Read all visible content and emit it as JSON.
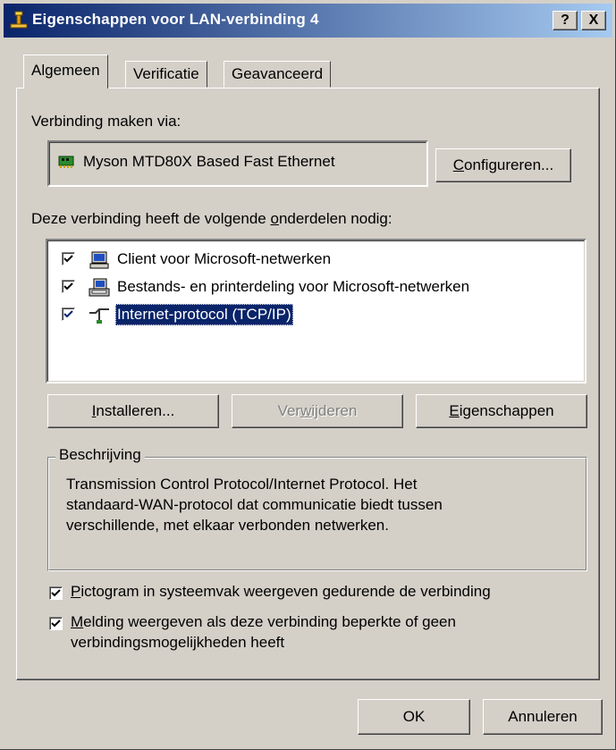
{
  "window": {
    "title": "Eigenschappen voor LAN-verbinding 4",
    "help_label": "?",
    "close_label": "X"
  },
  "tabs": [
    {
      "label": "Algemeen",
      "active": true
    },
    {
      "label": "Verificatie",
      "active": false
    },
    {
      "label": "Geavanceerd",
      "active": false
    }
  ],
  "connect_via": {
    "label": "Verbinding maken via:",
    "adapter": "Myson MTD80X Based Fast Ethernet",
    "configure_prefix": "",
    "configure_key": "C",
    "configure_rest": "onfigureren..."
  },
  "components": {
    "label_prefix": "Deze verbinding heeft de volgende ",
    "label_key": "o",
    "label_rest": "nderdelen nodig:",
    "items": [
      {
        "label": "Client voor Microsoft-netwerken",
        "checked": true,
        "icon": "network-client-icon",
        "selected": false
      },
      {
        "label": "Bestands- en printerdeling voor Microsoft-netwerken",
        "checked": true,
        "icon": "file-printer-sharing-icon",
        "selected": false
      },
      {
        "label": "Internet-protocol (TCP/IP)",
        "checked": true,
        "icon": "protocol-icon",
        "selected": true
      }
    ]
  },
  "buttons": {
    "install": {
      "key": "I",
      "rest": "nstalleren..."
    },
    "remove": {
      "pre": "Ver",
      "key": "w",
      "rest": "ijderen"
    },
    "properties": {
      "key": "E",
      "rest": "igenschappen"
    }
  },
  "description": {
    "legend": "Beschrijving",
    "lines": [
      "Transmission Control Protocol/Internet Protocol. Het",
      "standaard-WAN-protocol dat communicatie biedt tussen",
      "verschillende, met elkaar verbonden netwerken."
    ]
  },
  "options": {
    "tray_icon": {
      "key": "P",
      "rest": "ictogram in systeemvak weergeven gedurende de verbinding",
      "checked": true
    },
    "notify": {
      "key": "M",
      "line1_rest": "elding weergeven als deze verbinding beperkte of geen",
      "line2": "verbindingsmogelijkheden heeft",
      "checked": true
    }
  },
  "footer": {
    "ok_label": "OK",
    "cancel_label": "Annuleren"
  },
  "colors": {
    "title_start": "#0a246a",
    "title_end": "#a6caf0",
    "selection": "#0a246a",
    "face": "#d4d0c8"
  }
}
